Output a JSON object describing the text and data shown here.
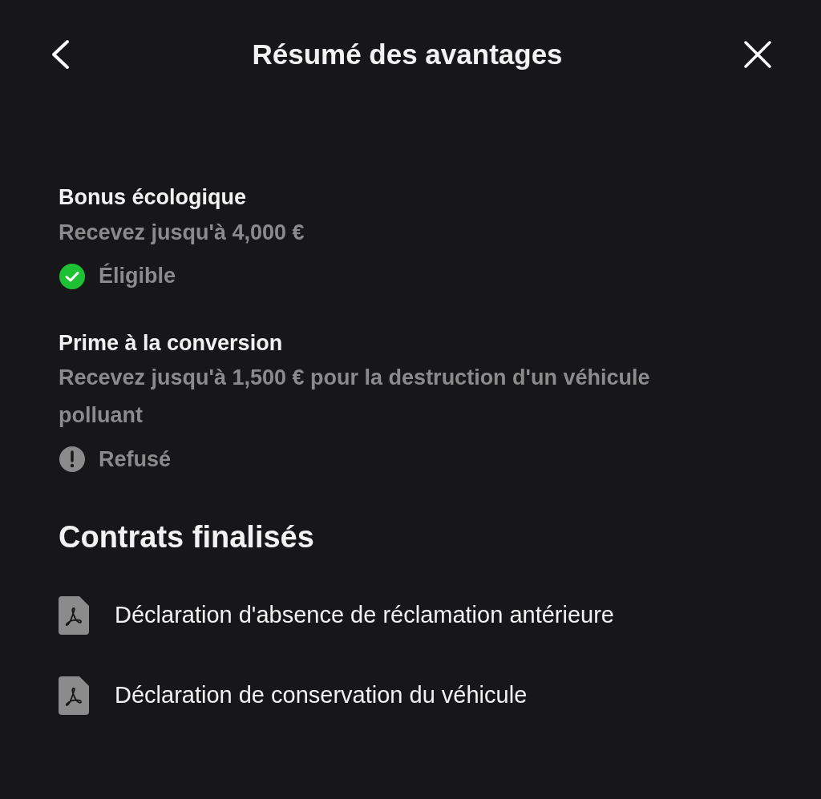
{
  "header": {
    "title": "Résumé des avantages"
  },
  "benefits": [
    {
      "title": "Bonus écologique",
      "description": "Recevez jusqu'à 4,000 €",
      "status": {
        "kind": "eligible",
        "label": "Éligible"
      }
    },
    {
      "title": "Prime à la conversion",
      "description": "Recevez jusqu'à 1,500 € pour la destruction d'un véhicule polluant",
      "status": {
        "kind": "refused",
        "label": "Refusé"
      }
    }
  ],
  "contracts": {
    "heading": "Contrats finalisés",
    "documents": [
      {
        "name": "Déclaration d'absence de réclamation antérieure"
      },
      {
        "name": "Déclaration de conservation du véhicule"
      }
    ]
  }
}
